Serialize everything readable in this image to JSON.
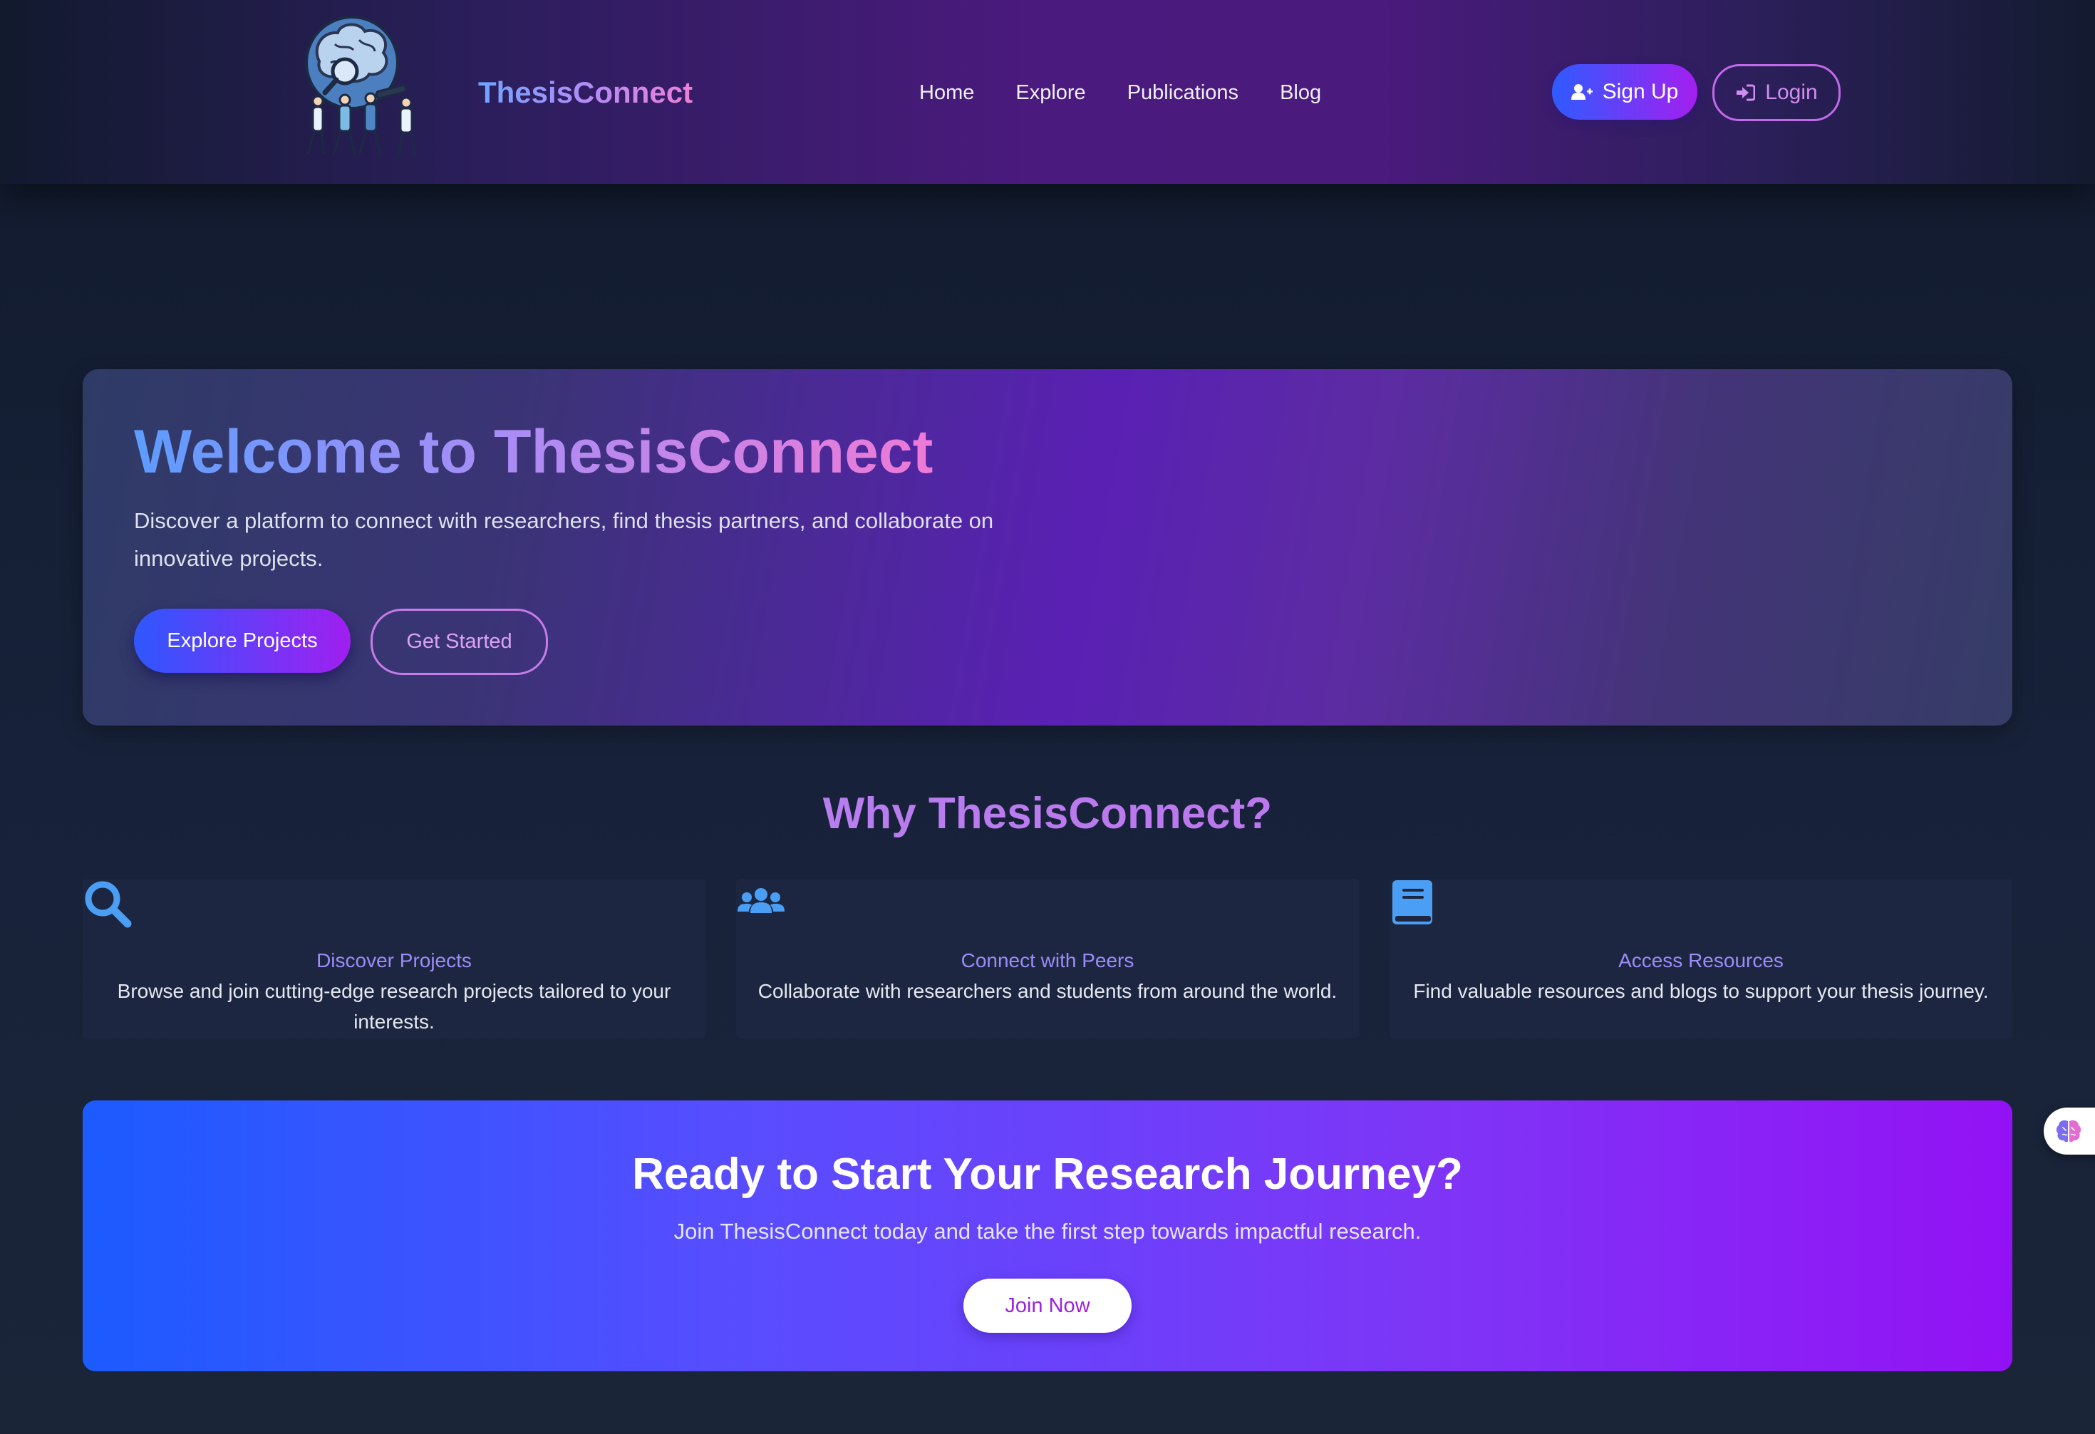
{
  "header": {
    "brand": "ThesisConnect",
    "nav": [
      "Home",
      "Explore",
      "Publications",
      "Blog"
    ],
    "signup_label": "Sign Up",
    "login_label": "Login"
  },
  "hero": {
    "title": "Welcome to ThesisConnect",
    "description": "Discover a platform to connect with researchers, find thesis partners, and collaborate on innovative projects.",
    "primary_button": "Explore Projects",
    "secondary_button": "Get Started"
  },
  "why": {
    "title": "Why ThesisConnect?",
    "features": [
      {
        "icon": "search-icon",
        "title": "Discover Projects",
        "description": "Browse and join cutting-edge research projects tailored to your interests."
      },
      {
        "icon": "users-icon",
        "title": "Connect with Peers",
        "description": "Collaborate with researchers and students from around the world."
      },
      {
        "icon": "book-icon",
        "title": "Access Resources",
        "description": "Find valuable resources and blogs to support your thesis journey."
      }
    ]
  },
  "cta": {
    "title": "Ready to Start Your Research Journey?",
    "description": "Join ThesisConnect today and take the first step towards impactful research.",
    "button": "Join Now"
  },
  "floating_widget": {
    "icon": "brain-icon"
  },
  "colors": {
    "accent_blue": "#2f5bff",
    "accent_purple": "#a41ff0",
    "feature_title": "#9c8cf8",
    "icon_blue": "#4a9ff5"
  }
}
